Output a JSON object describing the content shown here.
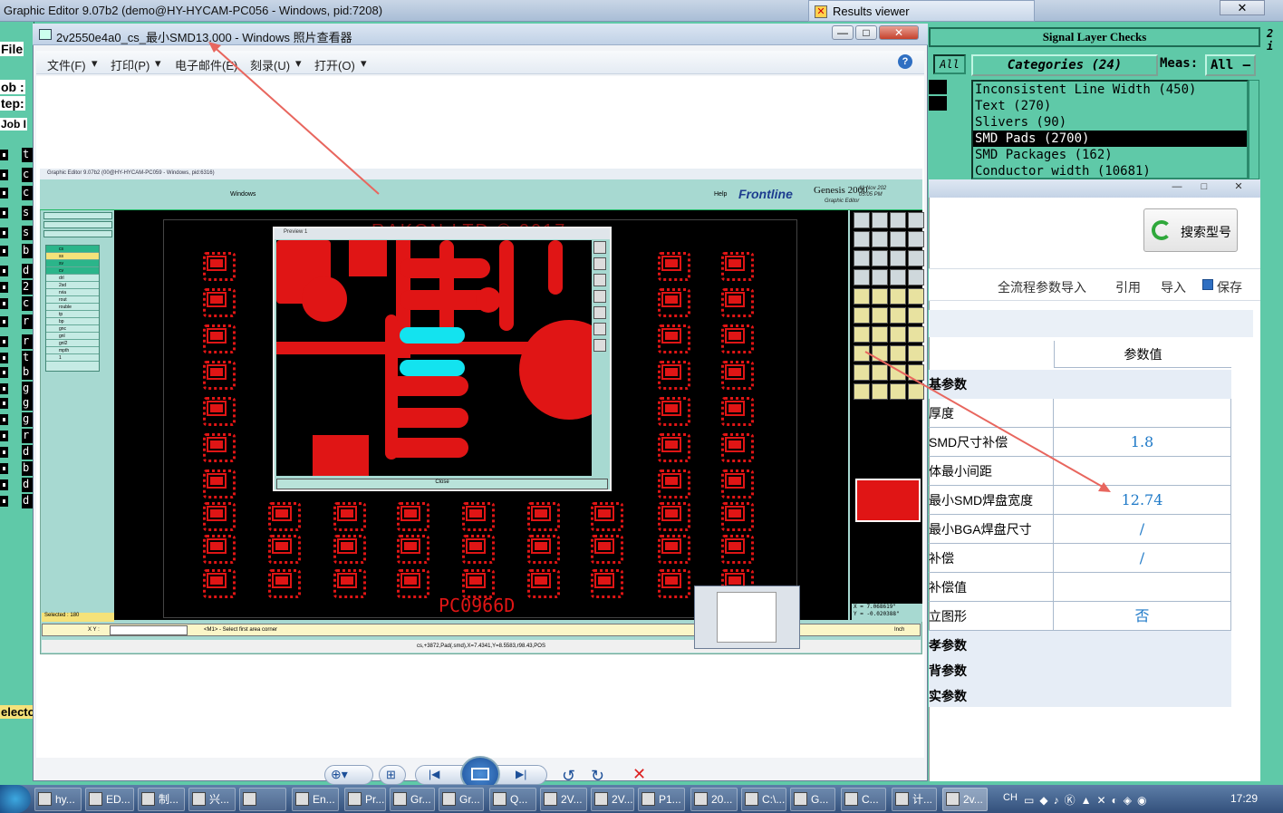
{
  "bg_window": {
    "title": "Graphic Editor 9.07b2 (demo@HY-HYCAM-PC056 - Windows, pid:7208)",
    "results_tab": "Results viewer",
    "close": "✕",
    "menu_file": "File",
    "left_labels": [
      "ob :",
      "tep:",
      "Job I"
    ],
    "left_rows": [
      "t",
      "c",
      "c",
      "s",
      "s",
      "b",
      "d",
      "2",
      "c",
      "r",
      "r",
      "t",
      "b",
      "g",
      "g",
      "g",
      "r",
      "d",
      "b",
      "d",
      "d"
    ],
    "left_bottom": "electo"
  },
  "results": {
    "header": "Signal Layer Checks",
    "all_label": "All",
    "categories_label": "Categories (24)",
    "meas_label": "Meas:",
    "meas_value": "All",
    "items": [
      "Inconsistent Line Width (450)",
      "Text (270)",
      "Slivers (90)",
      "SMD Pads (2700)",
      "SMD Packages (162)",
      "Conductor width (10681)"
    ],
    "selected_index": 3,
    "top_right": "2 i"
  },
  "param_window": {
    "search_button": "搜索型号",
    "toolbar": [
      "全流程参数导入",
      "引用",
      "导入",
      "保存"
    ],
    "column_header": "参数值",
    "rows": [
      {
        "key": "基参数",
        "value": "",
        "group": true
      },
      {
        "key": "厚度",
        "value": ""
      },
      {
        "key": "SMD尺寸补偿",
        "value": "1.8"
      },
      {
        "key": "体最小间距",
        "value": ""
      },
      {
        "key": "最小SMD焊盘宽度",
        "value": "12.74"
      },
      {
        "key": "最小BGA焊盘尺寸",
        "value": "/"
      },
      {
        "key": "补偿",
        "value": "/"
      },
      {
        "key": "补偿值",
        "value": ""
      },
      {
        "key": "立图形",
        "value": "否"
      },
      {
        "key": "孝参数",
        "value": "",
        "group": true
      },
      {
        "key": "背参数",
        "value": "",
        "group": true
      },
      {
        "key": "实参数",
        "value": "",
        "group": true
      }
    ]
  },
  "photo_viewer": {
    "title": "2v2550e4a0_cs_最小SMD13.000 - Windows 照片查看器",
    "menu": [
      "文件(F)",
      "打印(P)",
      "电子邮件(E)",
      "刻录(U)",
      "打开(O)"
    ],
    "help": "?",
    "minimize": "—",
    "maximize": "□",
    "close": "✕"
  },
  "screenshot": {
    "title": "Graphic Editor 9.07b2 (00@HY-HYCAM-PC059 - Windows, pid:6316)",
    "menu_windows": "Windows",
    "menu_help": "Help",
    "frontline": "Frontline",
    "genesis": "Genesis 2000",
    "genesis_sub": "Graphic Editor",
    "date": "11 Nov 202",
    "time": "05:05 PM",
    "watermark": "RAKON LTD © 2017",
    "board_label": "PC0966D",
    "preview_title": "Preview 1",
    "preview_close": "Close",
    "selected": "Selected : 180",
    "xy_label": "X Y :",
    "prompt": "<M1> - Select first area corner",
    "inch": "Inch",
    "status": "cs,+3872,Pad(.smd),X=7.4341,Y=8.5583,r98.43,POS",
    "coord_x": "X = 7.068619\"",
    "coord_y": "Y = -0.020388\"",
    "layers": [
      "cs",
      "ss",
      "sv",
      "cv",
      "drl",
      "2sd",
      "rvia",
      "rout",
      "rouble",
      "tp",
      "bp",
      "gnc",
      "gnl",
      "gnl2",
      "mpth",
      "1"
    ]
  },
  "taskbar": {
    "items": [
      "hy...",
      "ED...",
      "制...",
      "兴...",
      "",
      "En...",
      "Pr...",
      "Gr...",
      "Gr...",
      "Q...",
      "2V...",
      "2V...",
      "P1...",
      "20...",
      "C:\\...",
      "G...",
      "C...",
      "计...",
      "2v..."
    ],
    "lang": "CH",
    "time": "17:29"
  },
  "colors": {
    "pcb_red": "#e01515",
    "pad_cyan": "#13e3ef",
    "genesis_teal": "#5fc9a8",
    "link_blue": "#1f7ac8"
  }
}
